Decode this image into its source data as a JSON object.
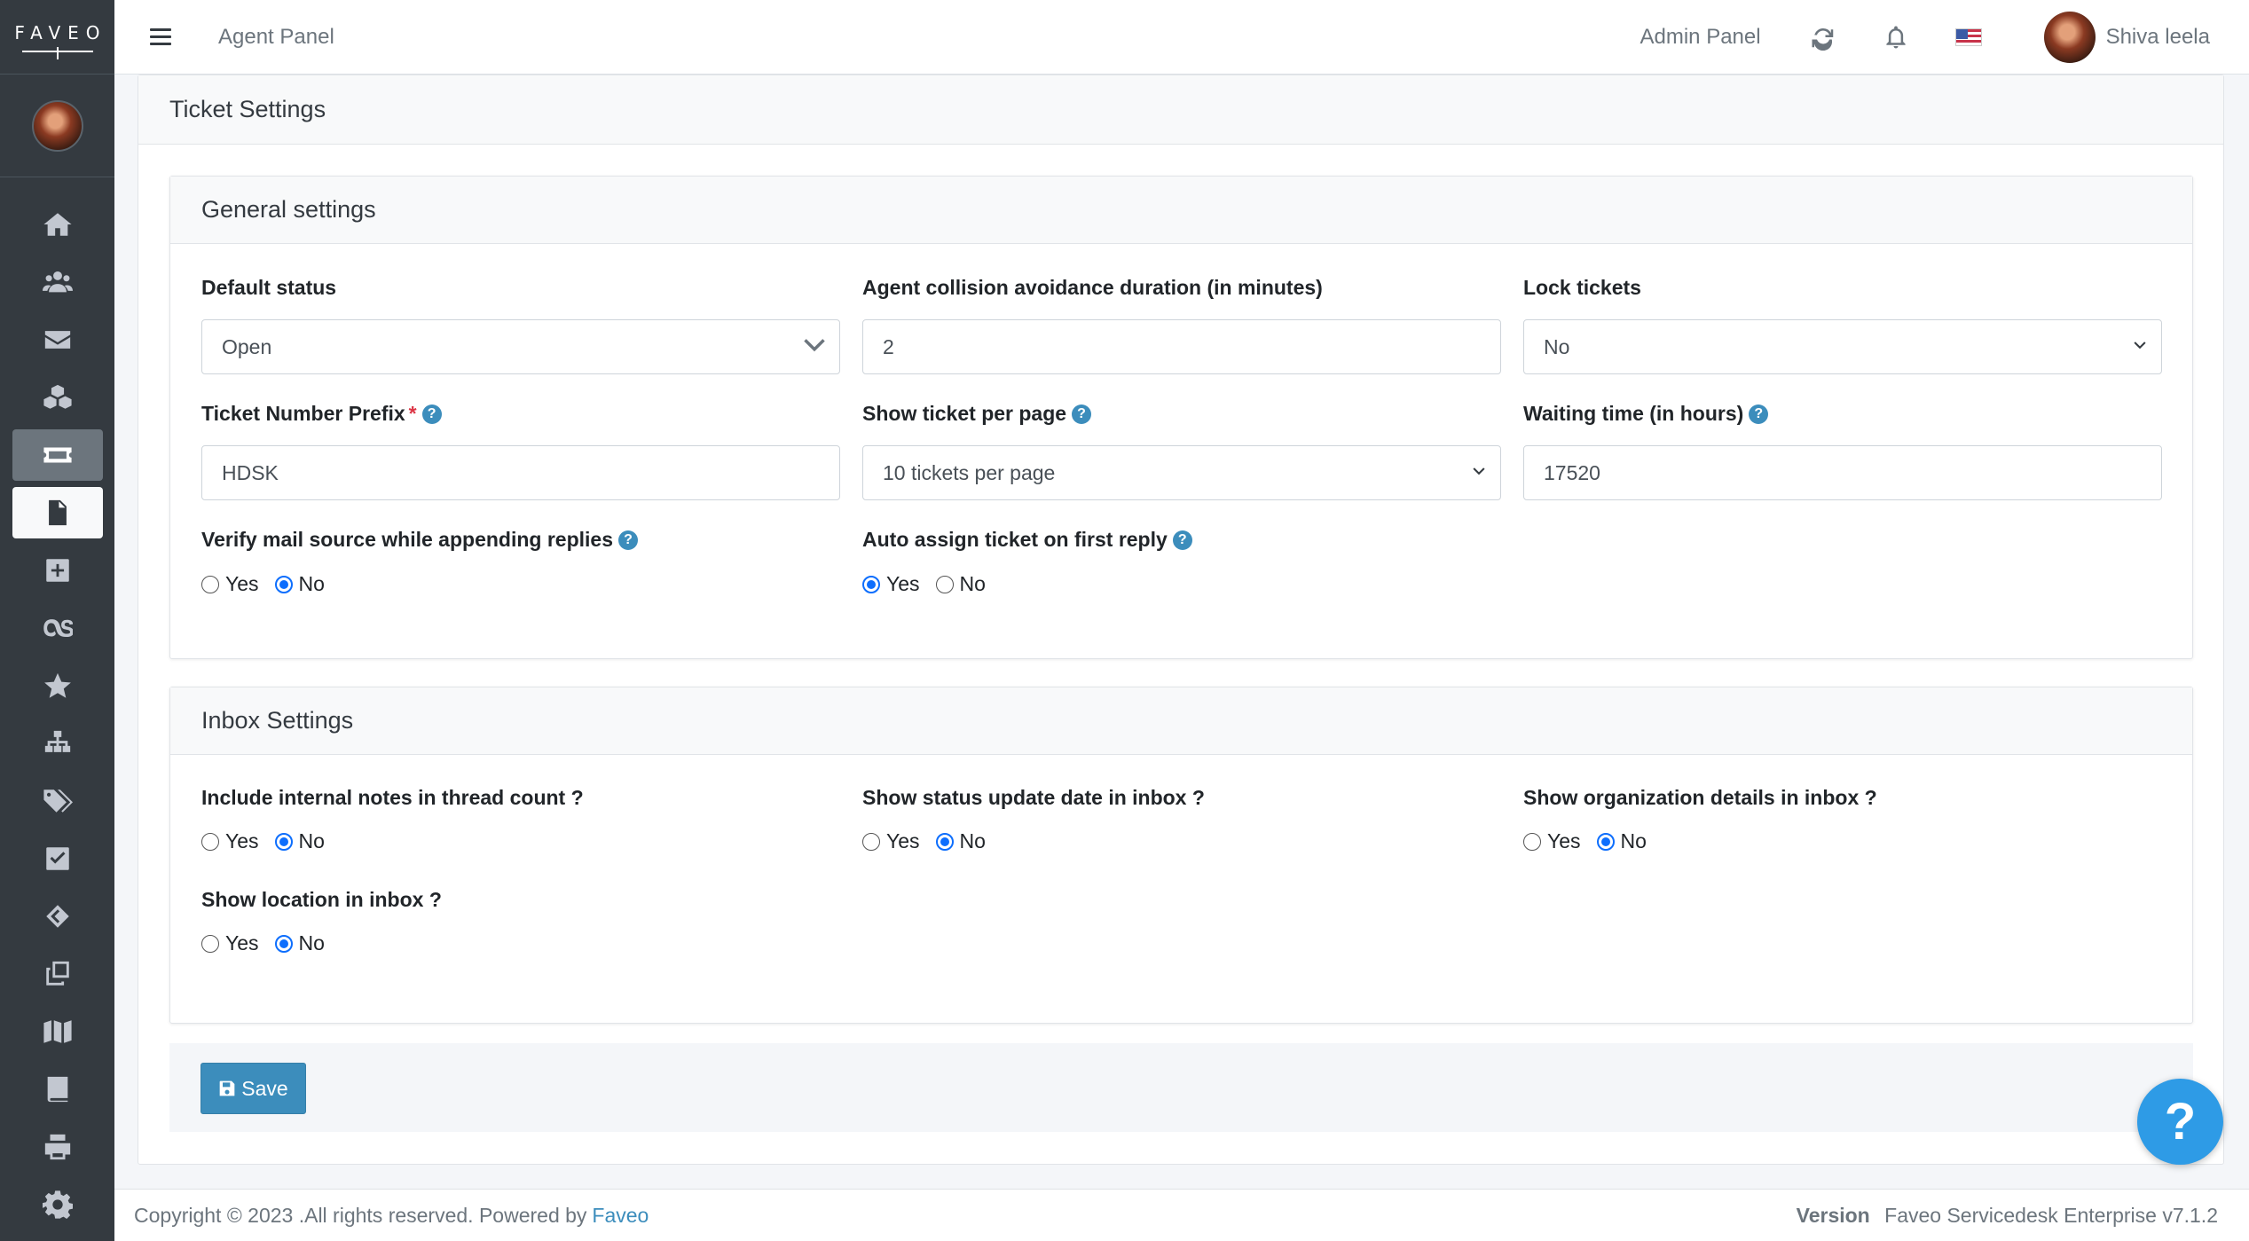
{
  "brand": {
    "logo_text": "FAVEO"
  },
  "topbar": {
    "agent_panel": "Agent Panel",
    "admin_panel": "Admin Panel",
    "user_name": "Shiva leela",
    "icons": [
      "menu-icon",
      "refresh-icon",
      "bell-icon",
      "us-flag-icon"
    ]
  },
  "sidebar": {
    "items": [
      "home",
      "users",
      "mail",
      "cubes",
      "ticket",
      "file-text",
      "plus-square",
      "lastfm",
      "star",
      "sitemap",
      "tags",
      "check-square",
      "code-fork",
      "copy",
      "map",
      "book",
      "print",
      "gear"
    ]
  },
  "page": {
    "title": "Ticket Settings"
  },
  "general": {
    "title": "General settings",
    "default_status": {
      "label": "Default status",
      "value": "Open"
    },
    "collision": {
      "label": "Agent collision avoidance duration (in minutes)",
      "value": "2"
    },
    "lock": {
      "label": "Lock tickets",
      "value": "No"
    },
    "prefix": {
      "label": "Ticket Number Prefix",
      "required": "*",
      "value": "HDSK"
    },
    "per_page": {
      "label": "Show ticket per page",
      "value": "10 tickets per page"
    },
    "waiting": {
      "label": "Waiting time (in hours)",
      "value": "17520"
    },
    "verify_mail": {
      "label": "Verify mail source while appending replies",
      "yes": "Yes",
      "no": "No",
      "selected": "No"
    },
    "auto_assign": {
      "label": "Auto assign ticket on first reply",
      "yes": "Yes",
      "no": "No",
      "selected": "Yes"
    }
  },
  "inbox": {
    "title": "Inbox Settings",
    "internal_notes": {
      "label": "Include internal notes in thread count ?",
      "yes": "Yes",
      "no": "No",
      "selected": "No"
    },
    "status_date": {
      "label": "Show status update date in inbox ?",
      "yes": "Yes",
      "no": "No",
      "selected": "No"
    },
    "org_details": {
      "label": "Show organization details in inbox ?",
      "yes": "Yes",
      "no": "No",
      "selected": "No"
    },
    "location": {
      "label": "Show location in inbox ?",
      "yes": "Yes",
      "no": "No",
      "selected": "No"
    }
  },
  "actions": {
    "save": "Save",
    "help": "?"
  },
  "footer": {
    "copyright": "Copyright © 2023 .All rights reserved. Powered by",
    "powered_link": "Faveo",
    "version_label": "Version",
    "version_value": "Faveo Servicedesk Enterprise v7.1.2"
  },
  "colors": {
    "sidebar": "#343a40",
    "primary": "#3c8dbc",
    "radio": "#0d6efd",
    "fab": "#2e9be6"
  }
}
